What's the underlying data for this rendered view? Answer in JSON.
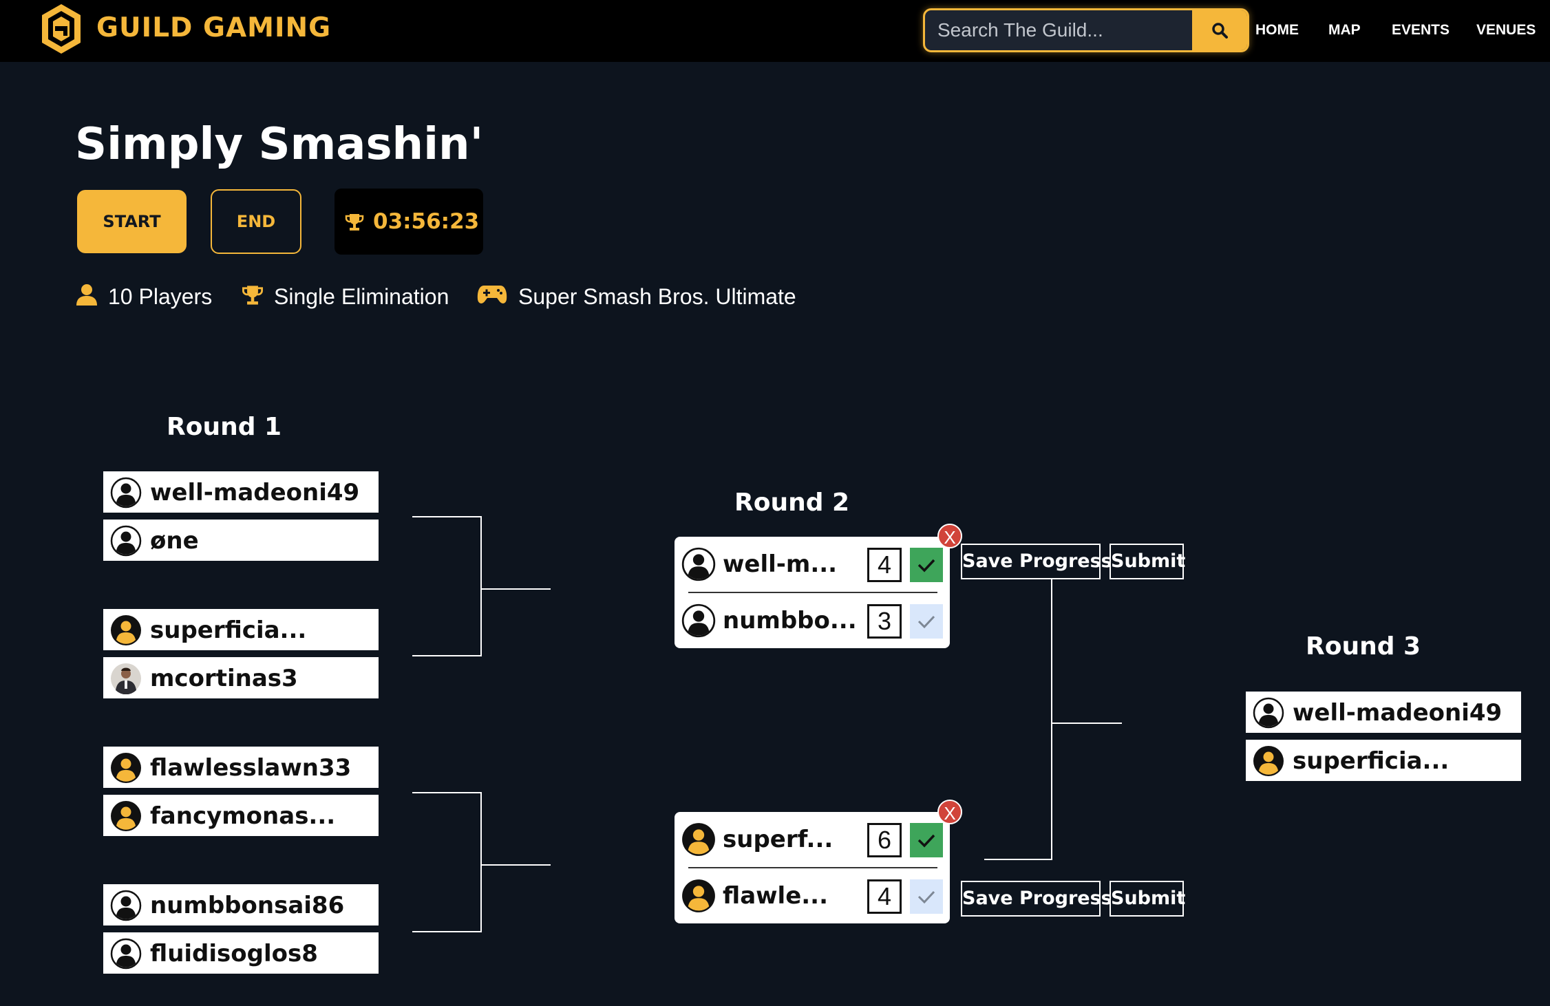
{
  "nav": {
    "brand": "GUILD GAMING",
    "search_placeholder": "Search The Guild...",
    "links": [
      "HOME",
      "MAP",
      "EVENTS",
      "VENUES"
    ]
  },
  "event": {
    "title": "Simply Smashin'",
    "start_label": "START",
    "end_label": "END",
    "timer": "03:56:23",
    "players": "10 Players",
    "format": "Single Elimination",
    "game": "Super Smash Bros. Ultimate"
  },
  "colors": {
    "accent": "#f5b73a",
    "background": "#0d141e",
    "nav_bg": "#000000",
    "check_active": "#3ea55a",
    "check_inactive": "#d9e7fb",
    "close": "#d1443a"
  },
  "round1": {
    "title": "Round 1",
    "slots": [
      {
        "name": "well-madeoni49",
        "avatar": "default-avatar-icon"
      },
      {
        "name": "øne",
        "avatar": "default-avatar-icon"
      },
      {
        "name": "superficia...",
        "avatar": "yellow-avatar-icon"
      },
      {
        "name": "mcortinas3",
        "avatar": "photo-avatar"
      },
      {
        "name": "flawlesslawn33",
        "avatar": "yellow-avatar-icon"
      },
      {
        "name": "fancymonas...",
        "avatar": "yellow-avatar-icon"
      },
      {
        "name": "numbbonsai86",
        "avatar": "default-avatar-icon"
      },
      {
        "name": "fluidisoglos8",
        "avatar": "default-avatar-icon"
      }
    ]
  },
  "round2": {
    "title": "Round 2",
    "save_label": "Save Progress",
    "submit_label": "Submit",
    "close_label": "X",
    "matches": [
      {
        "players": [
          {
            "name": "well-m...",
            "score": "4",
            "winner": true,
            "avatar": "default-avatar-icon"
          },
          {
            "name": "numbbo...",
            "score": "3",
            "winner": false,
            "avatar": "default-avatar-icon"
          }
        ]
      },
      {
        "players": [
          {
            "name": "superf...",
            "score": "6",
            "winner": true,
            "avatar": "yellow-avatar-icon"
          },
          {
            "name": "flawle...",
            "score": "4",
            "winner": false,
            "avatar": "yellow-avatar-icon"
          }
        ]
      }
    ]
  },
  "round3": {
    "title": "Round 3",
    "slots": [
      {
        "name": "well-madeoni49",
        "avatar": "default-avatar-icon"
      },
      {
        "name": "superficia...",
        "avatar": "yellow-avatar-icon"
      }
    ]
  }
}
